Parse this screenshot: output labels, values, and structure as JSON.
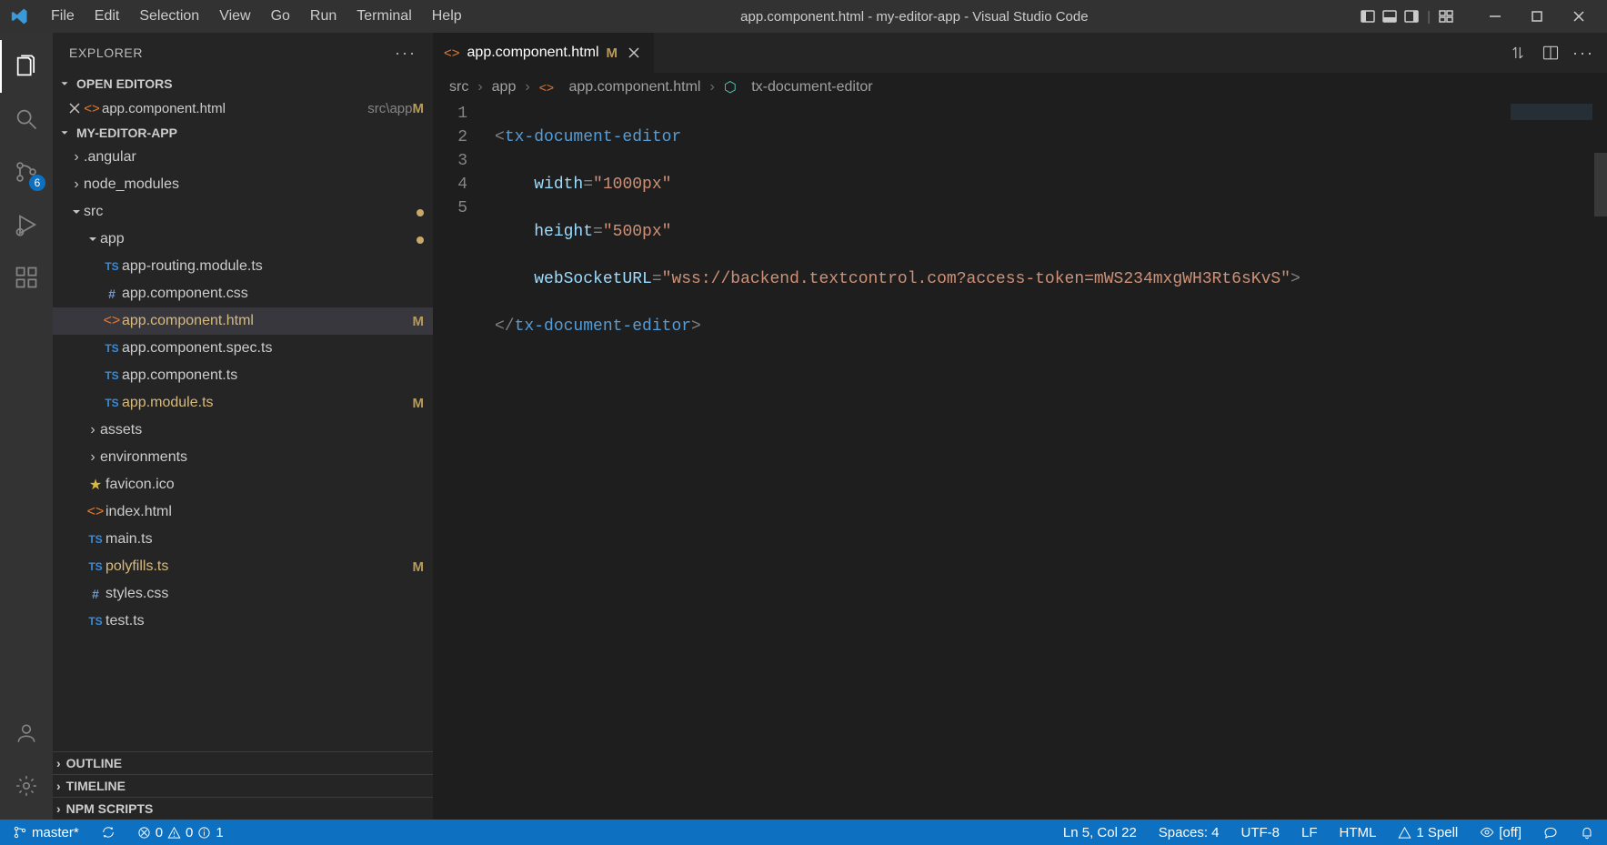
{
  "window_title": "app.component.html - my-editor-app - Visual Studio Code",
  "menus": [
    "File",
    "Edit",
    "Selection",
    "View",
    "Go",
    "Run",
    "Terminal",
    "Help"
  ],
  "activity": {
    "scm_badge": "6"
  },
  "explorer": {
    "title": "EXPLORER",
    "open_editors_label": "OPEN EDITORS",
    "open_editor": {
      "name": "app.component.html",
      "path": "src\\app",
      "mod": "M"
    },
    "project_label": "MY-EDITOR-APP",
    "outline_label": "OUTLINE",
    "timeline_label": "TIMELINE",
    "npm_label": "NPM SCRIPTS",
    "tree": {
      "angular": ".angular",
      "node_modules": "node_modules",
      "src": "src",
      "app": "app",
      "files": {
        "routing": "app-routing.module.ts",
        "css": "app.component.css",
        "html": "app.component.html",
        "spec": "app.component.spec.ts",
        "ts": "app.component.ts",
        "module": "app.module.ts",
        "assets": "assets",
        "envs": "environments",
        "favicon": "favicon.ico",
        "index": "index.html",
        "main": "main.ts",
        "polyfills": "polyfills.ts",
        "styles": "styles.css",
        "test": "test.ts"
      },
      "mods": {
        "html": "M",
        "module": "M",
        "polyfills": "M"
      }
    }
  },
  "tab": {
    "name": "app.component.html",
    "mod": "M"
  },
  "breadcrumb": {
    "s1": "src",
    "s2": "app",
    "s3": "app.component.html",
    "s4": "tx-document-editor"
  },
  "code": {
    "l1_open": "<",
    "l1_tag": "tx-document-editor",
    "l2_attr": "width",
    "l2_eq": "=",
    "l2_val": "\"1000px\"",
    "l3_attr": "height",
    "l3_eq": "=",
    "l3_val": "\"500px\"",
    "l4_attr": "webSocketURL",
    "l4_eq": "=",
    "l4_val": "\"wss://backend.textcontrol.com?access-token=mWS234mxgWH3Rt6sKvS\"",
    "l4_close": ">",
    "l5_open": "</",
    "l5_tag": "tx-document-editor",
    "l5_close": ">"
  },
  "line_numbers": [
    "1",
    "2",
    "3",
    "4",
    "5"
  ],
  "status": {
    "branch": "master*",
    "err_block": "0",
    "err_warn": "0",
    "err_info": "1",
    "cursor": "Ln 5, Col 22",
    "spaces": "Spaces: 4",
    "encoding": "UTF-8",
    "eol": "LF",
    "lang": "HTML",
    "spell": "1 Spell",
    "off": "[off]"
  }
}
